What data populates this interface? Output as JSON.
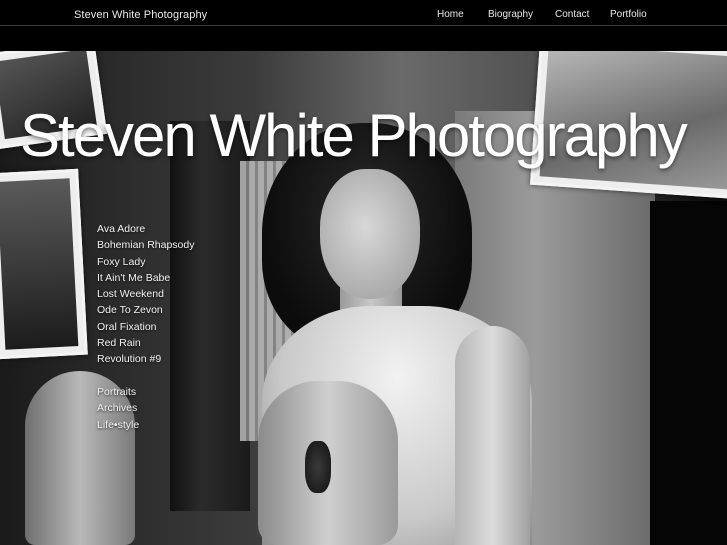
{
  "header": {
    "site_title": "Steven White Photography",
    "nav": [
      "Home",
      "Biography",
      "Contact",
      "Portfolio"
    ]
  },
  "hero": {
    "title": "Steven White Photography"
  },
  "galleries": {
    "series": [
      "Ava Adore",
      "Bohemian Rhapsody",
      "Foxy Lady",
      "It Ain't Me Babe",
      "Lost Weekend",
      "Ode To Zevon",
      "Oral Fixation",
      "Red Rain",
      "Revolution #9"
    ],
    "collections": [
      "Portraits",
      "Archives",
      "Life•style"
    ]
  }
}
